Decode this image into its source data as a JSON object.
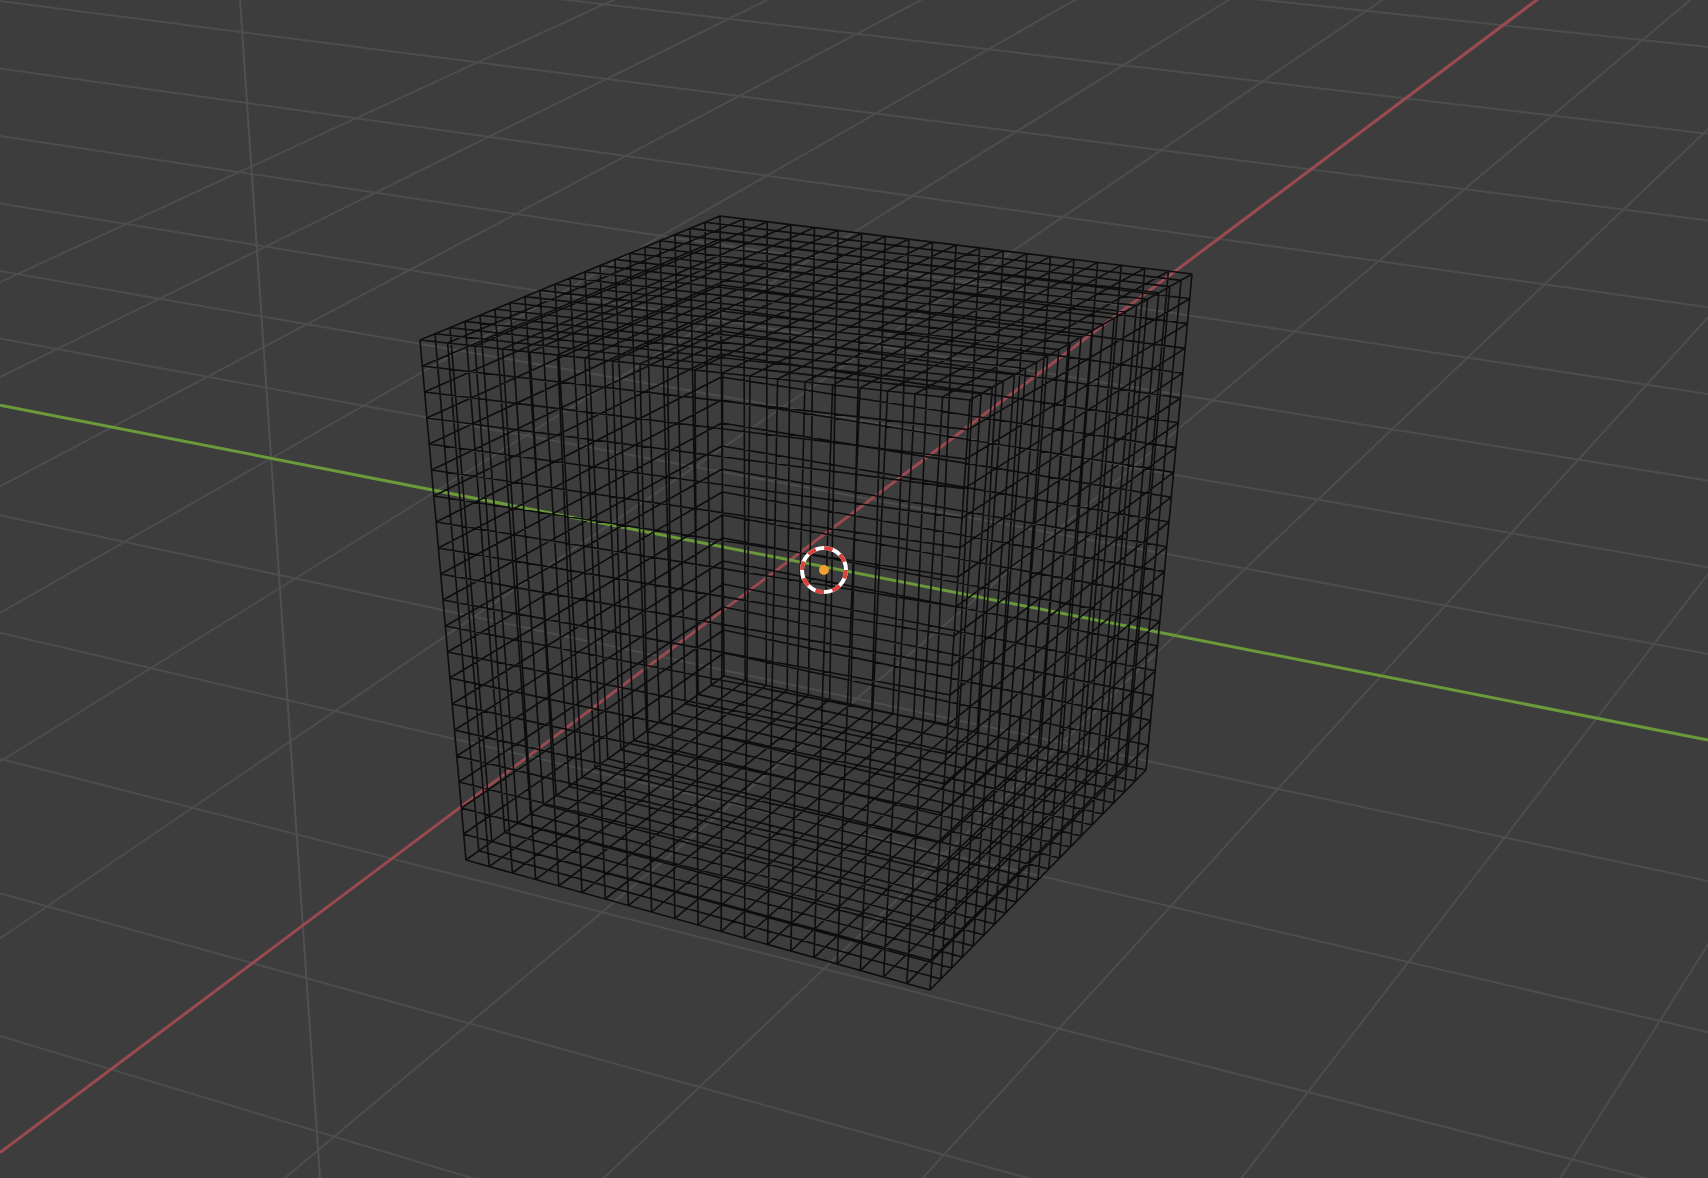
{
  "viewport": {
    "grid": true,
    "axes": [
      {
        "kind": "x",
        "color": "#9b4a52"
      },
      {
        "kind": "y",
        "color": "#6b9a3a"
      }
    ],
    "objects": [
      {
        "kind": "wireframe-cube",
        "selected": false
      }
    ],
    "cursor_3d": true
  }
}
